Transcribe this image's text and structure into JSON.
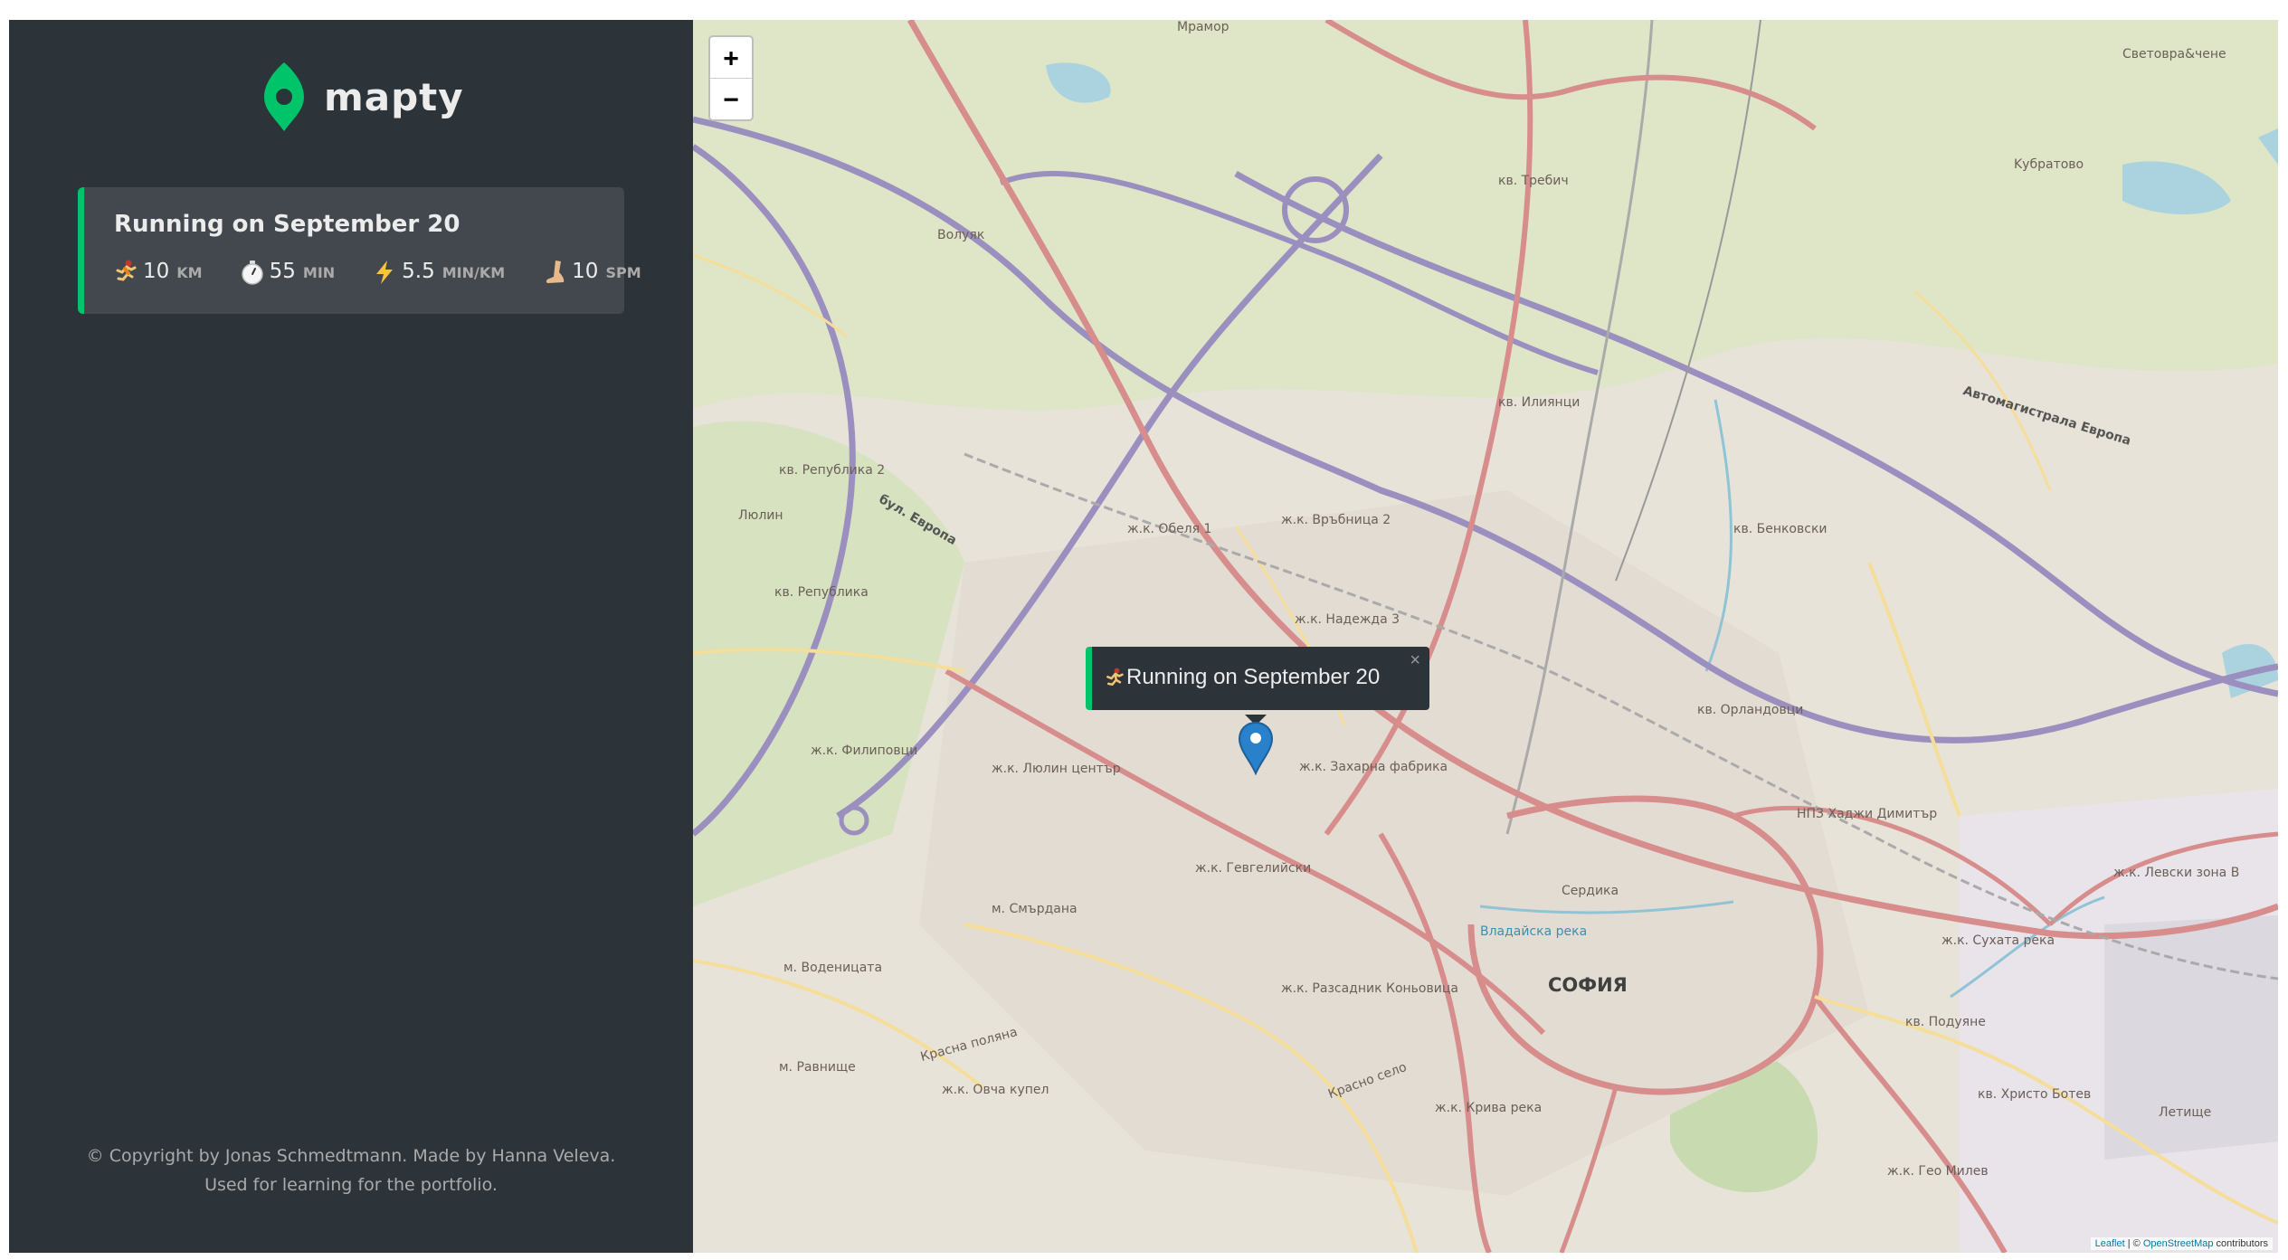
{
  "app": {
    "name": "mapty"
  },
  "colors": {
    "sidebar_bg": "#2d3439",
    "card_bg": "#42484d",
    "accent_running": "#00c46a",
    "text": "#ececec",
    "muted": "#aaaaaa"
  },
  "workouts": [
    {
      "title": "Running on September 20",
      "type": "running",
      "stats": [
        {
          "icon": "runner-icon",
          "value": "10",
          "unit": "km"
        },
        {
          "icon": "stopwatch-icon",
          "value": "55",
          "unit": "min"
        },
        {
          "icon": "lightning-icon",
          "value": "5.5",
          "unit": "min/km"
        },
        {
          "icon": "footprint-icon",
          "value": "10",
          "unit": "spm"
        }
      ]
    }
  ],
  "footer": {
    "copyright": "© Copyright by Jonas Schmedtmann. Made by Hanna Veleva. Used for learning for the portfolio."
  },
  "map": {
    "zoom_in_label": "+",
    "zoom_out_label": "−",
    "popup": {
      "text": "Running on September 20",
      "close_label": "×"
    },
    "attribution": {
      "leaflet": "Leaflet",
      "sep": " | © ",
      "osm": "OpenStreetMap",
      "suffix": " contributors"
    },
    "labels": [
      "Мрамор",
      "кв. Требич",
      "Волуяк",
      "Kубратово",
      "Световра&чене",
      "кв. Илиянци",
      "Автомагистрала Европа",
      "кв. Република 2",
      "Люлин",
      "бул. Европа",
      "ж.к. Обеля 1",
      "ж.к. Връбница 2",
      "кв. Бенковски",
      "кв. Република",
      "ж.к. Надежда 3",
      "кв. Орландовци",
      "ж.к. Захарна фабрика",
      "ж.к. Филиповци",
      "ж.к. Люлин център",
      "НПЗ Хаджи Димитър",
      "ж.к. Гевгелийски",
      "м. Смърдана",
      "Сердика",
      "Владайска река",
      "м. Воденицата",
      "СОФИЯ",
      "ж.к. Разсадник Коньовица",
      "ж.к. Сухата река",
      "кв. Подуяне",
      "м. Равнище",
      "ж.к. Овча купел",
      "Красна поляна",
      "Красно село",
      "ж.к. Крива река",
      "кв. Христо Ботев",
      "ж.к. Гео Милев",
      "ж.к. Левски зона В",
      "Летище"
    ]
  }
}
